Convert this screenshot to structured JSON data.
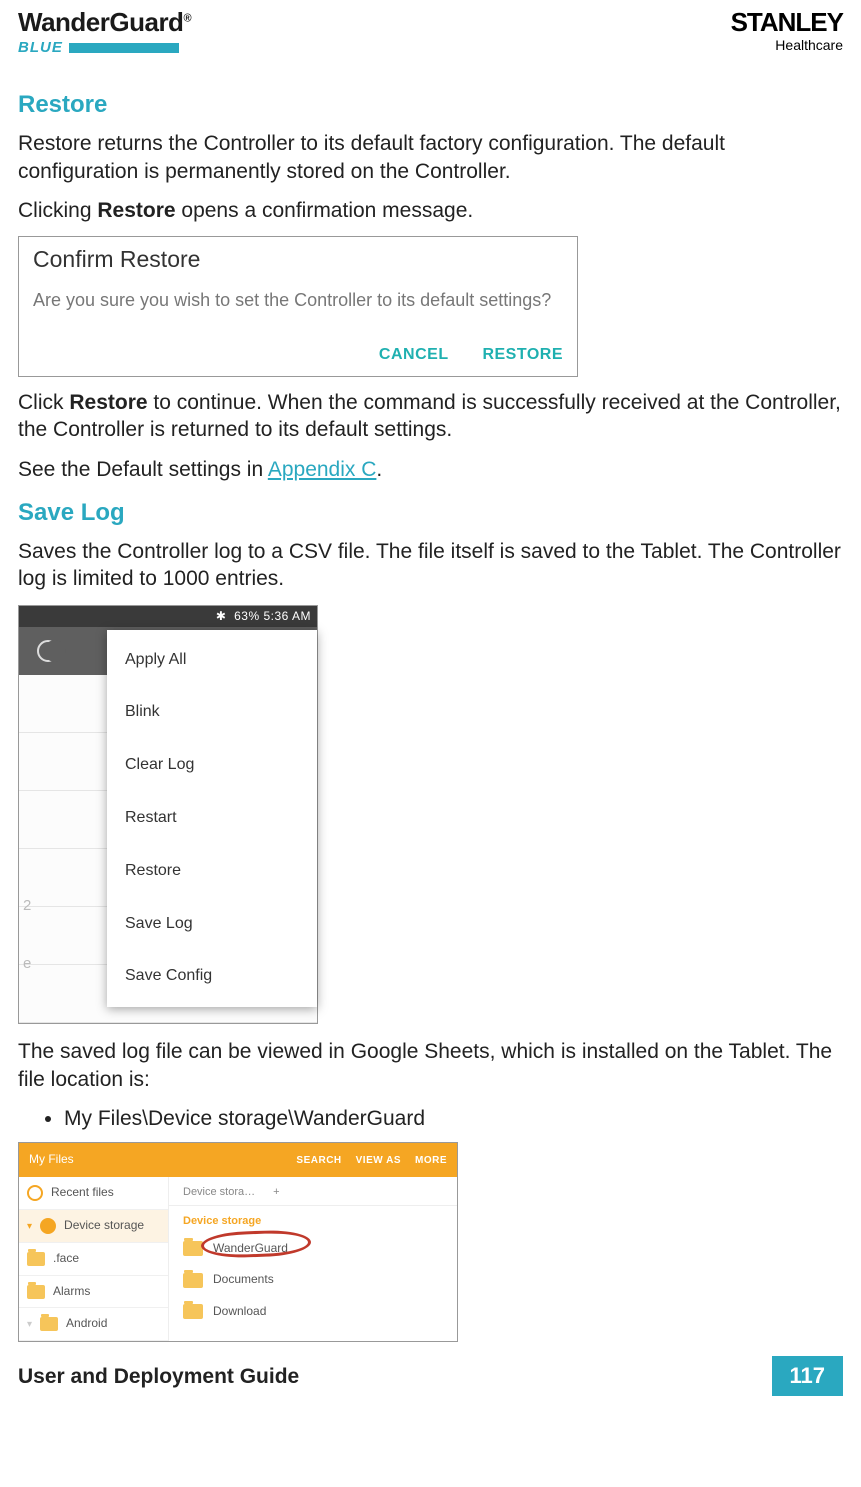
{
  "header": {
    "product_name": "WanderGuard",
    "product_reg": "®",
    "product_sub": "BLUE",
    "company_name": "STANLEY",
    "company_sub": "Healthcare"
  },
  "restore": {
    "heading": "Restore",
    "p1": "Restore returns the Controller to its default factory configuration. The default configuration is permanently stored on the Controller.",
    "p2_pre": "Clicking ",
    "p2_bold": "Restore",
    "p2_post": " opens a confirmation message.",
    "dialog": {
      "title": "Confirm Restore",
      "message": "Are you sure you wish to set the Controller to its default settings?",
      "cancel": "CANCEL",
      "restore": "RESTORE"
    },
    "p3_pre": "Click ",
    "p3_bold": "Restore",
    "p3_post": " to continue. When the command is successfully received at the Controller, the Controller is returned to its default settings.",
    "p4_pre": "See the Default settings in ",
    "p4_link": "Appendix C",
    "p4_post": "."
  },
  "savelog": {
    "heading": "Save Log",
    "p1": "Saves the Controller log to a CSV file. The file itself is saved to the Tablet. The Controller log is limited to 1000 entries.",
    "status_text": "63%  5:36 AM",
    "bt_icon": "✱",
    "menu_items": [
      "Apply All",
      "Blink",
      "Clear Log",
      "Restart",
      "Restore",
      "Save Log",
      "Save Config"
    ],
    "p2": "The saved log file can be viewed in Google Sheets, which is installed on the Tablet. The file location is:",
    "bullet": "My Files\\Device storage\\WanderGuard"
  },
  "files": {
    "app_title": "My Files",
    "actions": [
      "SEARCH",
      "VIEW AS",
      "MORE"
    ],
    "sidebar": {
      "recent": "Recent files",
      "device": "Device storage",
      "folders": [
        ".face",
        "Alarms",
        "Android"
      ]
    },
    "tabs": {
      "device_short": "Device stora…",
      "plus": "+"
    },
    "crumb": "Device storage",
    "rows": [
      "WanderGuard",
      "Documents",
      "Download"
    ]
  },
  "footer": {
    "doc_title": "User and Deployment Guide",
    "page_number": "117"
  }
}
